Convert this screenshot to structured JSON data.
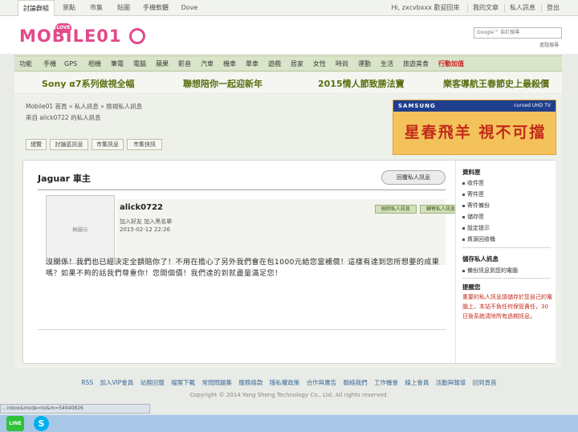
{
  "top_nav": {
    "tabs": [
      "討論群組",
      "景點",
      "市集",
      "貼圖",
      "手機軟體",
      "Dove"
    ],
    "greeting": "Hi, zxcvbxxx 歡迎回來",
    "right_links": [
      "我的文章",
      "私人訊息",
      "登出"
    ]
  },
  "header": {
    "logo_text": "MOBILE01",
    "logo_badge": "LOVE",
    "search_placeholder": "Google™ 自訂搜尋",
    "advanced_search": "進階搜尋"
  },
  "category_bar": {
    "items": [
      "功能",
      "手機",
      "GPS",
      "相機",
      "筆電",
      "電腦",
      "蘋果",
      "影音",
      "汽車",
      "機車",
      "單車",
      "遊戲",
      "居家",
      "女性",
      "時尚",
      "運動",
      "生活",
      "旅遊美食"
    ],
    "highlight": "行動加值"
  },
  "promos": [
    "Sony α7系列做視全幅",
    "聯想陪你一起迎新年",
    "2015情人節致勝法寶",
    "樂客導航王春節史上最殺價"
  ],
  "breadcrumb": "Mobile01 首頁 » 私人訊息 » 檢視私人訊息",
  "sub_crumb": "來自 alick0722 的私人訊息",
  "subtabs": [
    "總覽",
    "討論區訊息",
    "市集訊息",
    "市集快訊"
  ],
  "ad": {
    "brand": "SAMSUNG",
    "tag": "curved UHD TV",
    "text": "星春飛羊 視不可擋"
  },
  "message": {
    "page_title": "Jaguar 車主",
    "reply_button": "回覆私人訊息",
    "avatar_placeholder": "無圖示",
    "sender": "alick0722",
    "add_links": "加入好友  加入黑名單",
    "date": "2015-02-12 22:26",
    "delete_button": "刪除私人訊息",
    "forward_button": "轉寄私人訊息",
    "body": "沒關係！我們也已經決定全額賠你了！不用在擔心了另外我們會在包1000元給您當補償！這樣有達到您所想要的成果嗎？如果不夠的話我們尊重你！您開個價！我們達的到就盡量滿足您！"
  },
  "sidebar": {
    "mailbox_title": "資料匣",
    "mailbox_items": [
      "收件匣",
      "寄件匣",
      "寄件備份",
      "儲存匣",
      "設定提示",
      "資源回收桶"
    ],
    "save_title": "儲存私人訊息",
    "save_items": [
      "備份訊息到您的電腦"
    ],
    "notice_title": "提醒您",
    "notice_text": "重要的私人訊息請儲存於您自己的電腦上，本站不負任何保管責任，30日後系統清除所有過期訊息。"
  },
  "footer": {
    "links": [
      "RSS",
      "加入VIP會員",
      "站務回報",
      "檔案下載",
      "常問問題集",
      "服務條款",
      "隱私權政策",
      "合作與廣告",
      "聯絡我們",
      "工作機會",
      "線上會員",
      "活動與報導",
      "回到頁首"
    ],
    "copyright": "Copyright © 2014 Yong Sheng Technology Co., Ltd. All rights reserved."
  },
  "status_bar_url": "...inbox&mode=to&m=54940826",
  "taskbar": {
    "line_label": "LINE",
    "skype_label": "S"
  },
  "colors": {
    "accent_green": "#5a6f12",
    "brand_pink": "#e24a8a",
    "warning_red": "#c22a1b"
  }
}
